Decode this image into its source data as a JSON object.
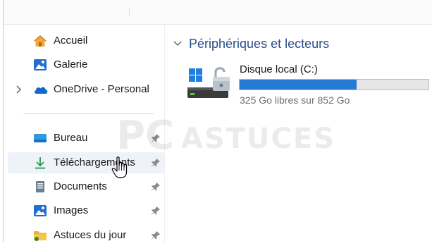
{
  "sidebar": {
    "items": [
      {
        "label": "Accueil",
        "icon": "home-icon"
      },
      {
        "label": "Galerie",
        "icon": "gallery-icon"
      },
      {
        "label": "OneDrive - Personal",
        "icon": "onedrive-cloud-icon"
      },
      {
        "label": "Bureau",
        "icon": "desktop-folder-icon"
      },
      {
        "label": "Téléchargements",
        "icon": "download-icon"
      },
      {
        "label": "Documents",
        "icon": "documents-icon"
      },
      {
        "label": "Images",
        "icon": "pictures-icon"
      },
      {
        "label": "Astuces du jour",
        "icon": "folder-icon"
      }
    ]
  },
  "main": {
    "section_title": "Périphériques et lecteurs",
    "drive": {
      "name": "Disque local (C:)",
      "free_text": "325 Go libres sur 852 Go",
      "used_fraction": 0.62
    }
  },
  "watermark": {
    "brand_pc": "PC",
    "brand_astuces": "ASTUCES"
  },
  "colors": {
    "accent": "#2679d4",
    "section_title": "#2a4d8a",
    "hover": "#eef3fa"
  }
}
